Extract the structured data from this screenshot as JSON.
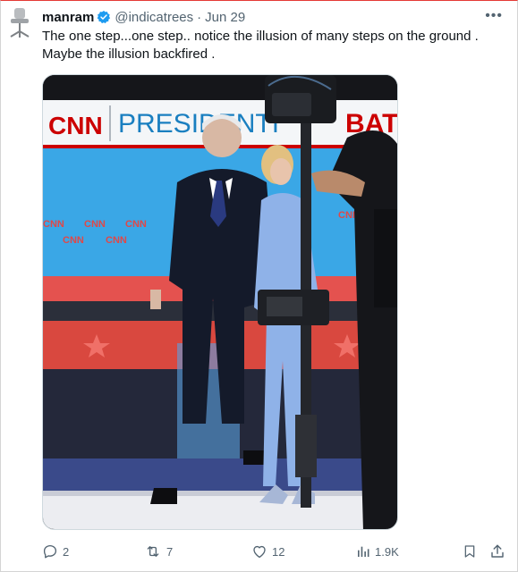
{
  "tweet": {
    "author_name": "manram",
    "handle": "@indicatrees",
    "separator": "·",
    "date": "Jun 29",
    "more_label": "•••",
    "text_line1": "The one step...one step.. notice the illusion of many steps on the ground .",
    "text_line2": "Maybe the illusion backfired ."
  },
  "media": {
    "banner_logo": "CNN",
    "banner_text": "PRESIDENTI",
    "banner_text_right": "BAT",
    "small_logo": "CNN"
  },
  "actions": {
    "replies": "2",
    "reposts": "7",
    "likes": "12",
    "views": "1.9K"
  },
  "colors": {
    "accent": "#1d9bf0",
    "text_secondary": "#536471",
    "cnn_red": "#cc0000"
  }
}
